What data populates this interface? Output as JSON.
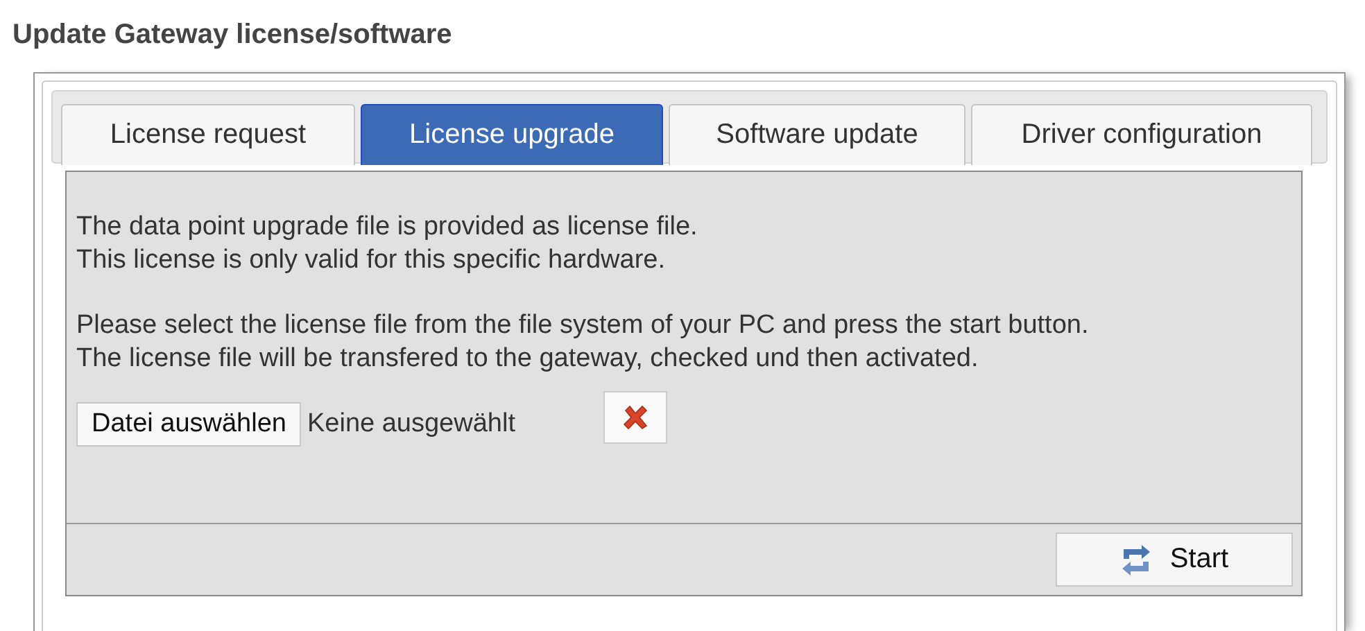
{
  "page_title": "Update Gateway license/software",
  "tabs": [
    {
      "label": "License request",
      "selected": false
    },
    {
      "label": "License upgrade",
      "selected": true
    },
    {
      "label": "Software update",
      "selected": false
    },
    {
      "label": "Driver configuration",
      "selected": false
    }
  ],
  "paragraphs": [
    [
      "The data point upgrade file is provided as license file.",
      "This license is only valid for this specific hardware."
    ],
    [
      "Please select the license file from the file system of your PC and press the start button.",
      "The license file will be transfered to the gateway, checked und then activated."
    ]
  ],
  "file_picker": {
    "button": "Datei auswählen",
    "status": "Keine ausgewählt"
  },
  "start_button": "Start"
}
